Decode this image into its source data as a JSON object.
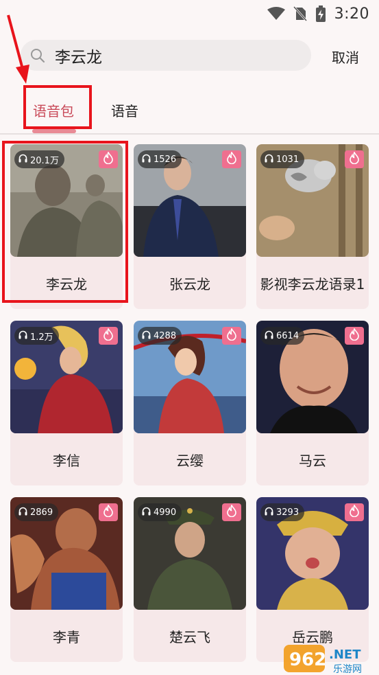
{
  "status_bar": {
    "time": "3:20",
    "icons": [
      "wifi-icon",
      "no-sim-icon",
      "battery-charging-icon"
    ]
  },
  "search": {
    "value": "李云龙",
    "cancel_label": "取消"
  },
  "tabs": [
    {
      "label": "语音包",
      "active": true
    },
    {
      "label": "语音",
      "active": false
    }
  ],
  "cards": [
    {
      "name": "李云龙",
      "plays": "20.1万",
      "hot": true
    },
    {
      "name": "张云龙",
      "plays": "1526",
      "hot": true
    },
    {
      "name": "影视李云龙语录1",
      "plays": "1031",
      "hot": true
    },
    {
      "name": "李信",
      "plays": "1.2万",
      "hot": true
    },
    {
      "name": "云缨",
      "plays": "4288",
      "hot": true
    },
    {
      "name": "马云",
      "plays": "6614",
      "hot": true
    },
    {
      "name": "李青",
      "plays": "2869",
      "hot": true
    },
    {
      "name": "楚云飞",
      "plays": "4990",
      "hot": true
    },
    {
      "name": "岳云鹏",
      "plays": "3293",
      "hot": true
    }
  ],
  "colors": {
    "accent": "#c94a59",
    "annotation": "#e8141c",
    "card_bg": "#f6e8e9",
    "hot_badge": "#ef6f8f"
  },
  "watermark": {
    "brand": "962",
    "suffix": ".NET",
    "sub": "乐游网"
  }
}
